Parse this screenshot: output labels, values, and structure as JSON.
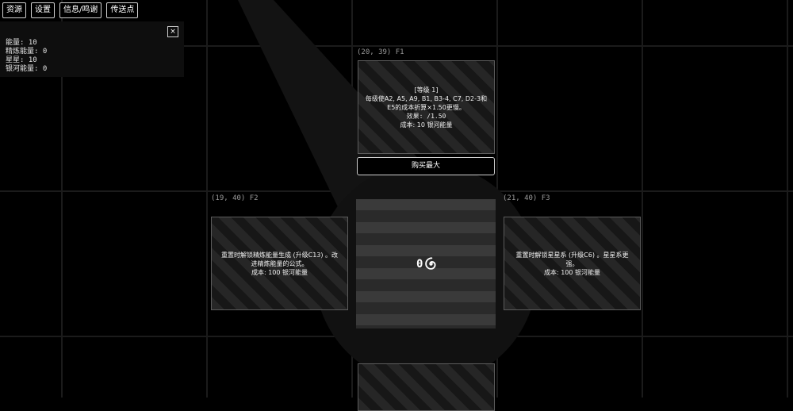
{
  "toolbar": {
    "resources": "资源",
    "settings": "设置",
    "info": "信息/鸣谢",
    "teleport": "传送点"
  },
  "resources_panel": {
    "close": "×",
    "energy": "能量: 10",
    "refined_energy": "精炼能量: 0",
    "stars": "星星: 10",
    "galaxy_energy": "银河能量: 0"
  },
  "nodes": {
    "top": {
      "coord": "(20, 39) F1",
      "level": "[等级 1]",
      "desc": "每级使A2, A5, A9, B1, B3-4, C7, D2-3和E5的成本折算×1.50更慢。",
      "effect": "效果: /1.50",
      "cost": "成本: 10 银河能量"
    },
    "left": {
      "coord": "(19, 40) F2",
      "desc": "重置时解锁精炼能量生成 (升级C13) 。改进精炼能量的公式。",
      "cost": "成本: 100 银河能量"
    },
    "right": {
      "coord": "(21, 40) F3",
      "desc": "重置时解锁星星系 (升级C6) 。星星系更强。",
      "cost": "成本: 100 银河能量"
    }
  },
  "buy_max": "购买最大",
  "center": {
    "counter": "0",
    "icon": "spiral-galaxy-icon"
  }
}
